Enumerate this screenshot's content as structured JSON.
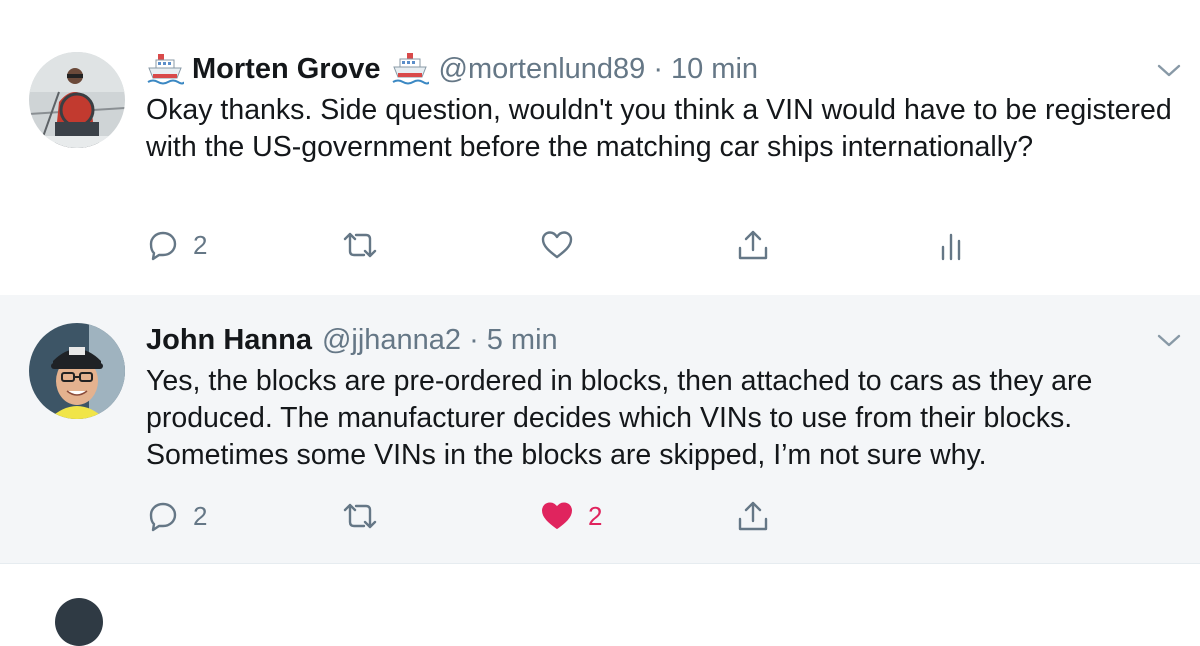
{
  "tweets": [
    {
      "display_name": "Morten Grove",
      "handle": "@mortenlund89",
      "separator": "·",
      "time": "10 min",
      "name_emoji": "ship-icon",
      "text": "Okay thanks. Side question, wouldn't you think a VIN would have to be registered with the US-government before the matching car ships internationally?",
      "actions": {
        "replies": "2",
        "retweets": "",
        "likes": "",
        "liked": false,
        "show_analytics": true
      }
    },
    {
      "display_name": "John Hanna",
      "handle": "@jjhanna2",
      "separator": "·",
      "time": "5 min",
      "text": "Yes, the blocks are pre-ordered in blocks, then attached to cars as they are produced.  The manufacturer decides which VINs to use from their blocks. Sometimes some VINs in the blocks are skipped, I’m not sure why.",
      "actions": {
        "replies": "2",
        "retweets": "",
        "likes": "2",
        "liked": true,
        "show_analytics": false
      }
    }
  ],
  "colors": {
    "text": "#14171a",
    "secondary": "#657786",
    "like": "#e0245e",
    "thread_line": "#c9d3db",
    "highlight_bg": "#f4f6f8"
  }
}
